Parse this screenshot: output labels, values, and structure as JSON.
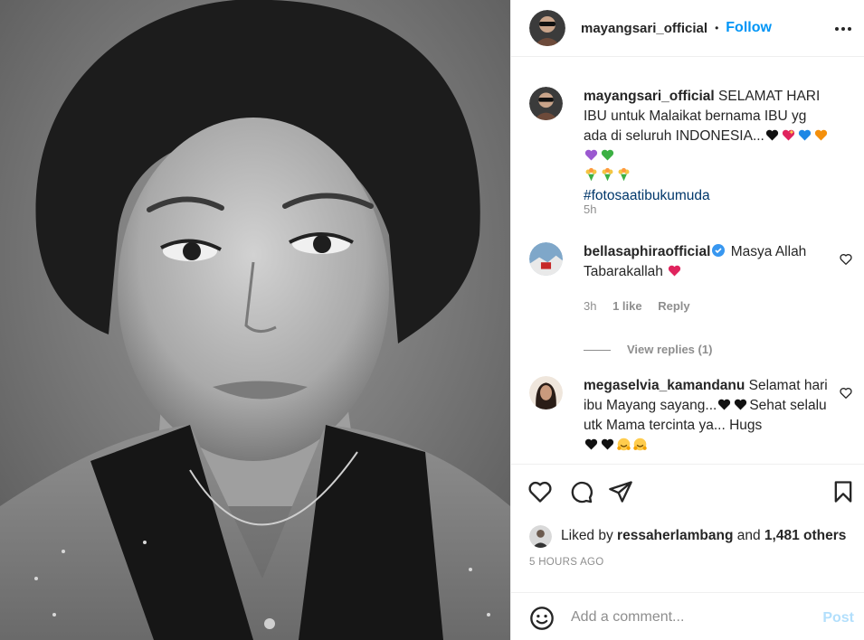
{
  "post": {
    "author": "mayangsari_official",
    "separator": "•",
    "follow_label": "Follow"
  },
  "caption": {
    "username": "mayangsari_official",
    "text": "SELAMAT HARI IBU untuk Malaikat bernama IBU yg ada di seluruh INDONESIA...",
    "emojis": [
      "black-heart",
      "sparkling-heart",
      "blue-heart",
      "orange-heart",
      "purple-heart",
      "green-heart",
      "bouquet",
      "bouquet",
      "bouquet"
    ],
    "hashtag": "#fotosaatibukumuda",
    "time": "5h"
  },
  "comments": [
    {
      "username": "bellasaphiraofficial",
      "verified": true,
      "text": "Masya Allah Tabarakallah",
      "emojis": [
        "red-heart"
      ],
      "time": "3h",
      "likes": "1 like",
      "reply_label": "Reply",
      "view_replies": "View replies (1)"
    },
    {
      "username": "megaselvia_kamandanu",
      "verified": false,
      "text_1": "Selamat hari ibu Mayang sayang...",
      "text_2": "Sehat selalu utk Mama tercinta ya... Hugs",
      "emojis": [
        "black-heart",
        "black-heart",
        "black-heart",
        "black-heart",
        "hugging-face",
        "hugging-face"
      ]
    }
  ],
  "likes": {
    "prefix": "Liked by",
    "user": "ressaherlambang",
    "joiner": "and",
    "others": "1,481 others"
  },
  "timestamp": "5 HOURS AGO",
  "add_comment": {
    "placeholder": "Add a comment...",
    "post_label": "Post"
  },
  "colors": {
    "accent": "#0095f6",
    "text": "#262626",
    "muted": "#8e8e8e",
    "hashtag": "#00376b",
    "divider": "#efefef",
    "post_disabled": "#b2dffc"
  }
}
